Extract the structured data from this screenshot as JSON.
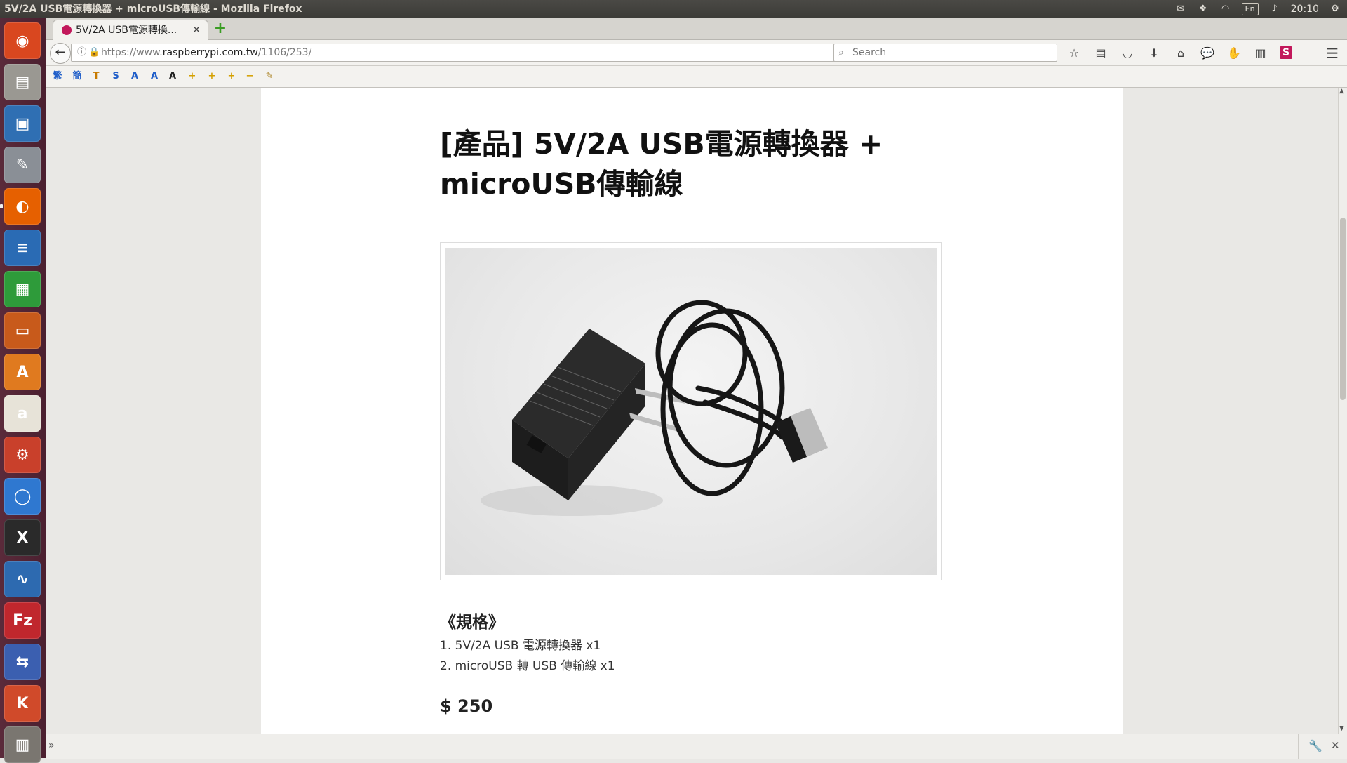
{
  "window": {
    "title": "5V/2A USB電源轉換器 + microUSB傳輸線 - Mozilla Firefox"
  },
  "tray": {
    "lang": "En",
    "clock": "20:10"
  },
  "launcher": {
    "apps": [
      {
        "name": "ubuntu-dash",
        "glyph": "◉",
        "color": "#d9471f"
      },
      {
        "name": "files",
        "glyph": "▤",
        "color": "#9a9892"
      },
      {
        "name": "remote-desktop",
        "glyph": "▣",
        "color": "#2f6fb3"
      },
      {
        "name": "image-editor",
        "glyph": "✎",
        "color": "#8a8f96"
      },
      {
        "name": "firefox",
        "glyph": "◐",
        "color": "#e66000"
      },
      {
        "name": "writer",
        "glyph": "≡",
        "color": "#2a6bb4"
      },
      {
        "name": "calc",
        "glyph": "▦",
        "color": "#2e9b3a"
      },
      {
        "name": "impress",
        "glyph": "▭",
        "color": "#c85a1b"
      },
      {
        "name": "software-center",
        "glyph": "A",
        "color": "#e07a1f"
      },
      {
        "name": "amazon",
        "glyph": "a",
        "color": "#e7e3d8"
      },
      {
        "name": "system-settings",
        "glyph": "⚙",
        "color": "#c9402b"
      },
      {
        "name": "chromium",
        "glyph": "◯",
        "color": "#2f78d0"
      },
      {
        "name": "xterm",
        "glyph": "X",
        "color": "#2a2a2a"
      },
      {
        "name": "system-monitor",
        "glyph": "∿",
        "color": "#2d6ab0"
      },
      {
        "name": "filezilla",
        "glyph": "Fz",
        "color": "#c0272d"
      },
      {
        "name": "network-tool",
        "glyph": "⇆",
        "color": "#3b5fb0"
      },
      {
        "name": "kdiff3",
        "glyph": "K",
        "color": "#d04a2a"
      },
      {
        "name": "stacked-apps",
        "glyph": "▥",
        "color": "#7a7670"
      }
    ]
  },
  "tabs": [
    {
      "label": "5V/2A USB電源轉換..."
    }
  ],
  "nav": {
    "url_prefix": "https://www.",
    "url_host": "raspberrypi.com.tw",
    "url_path": "/1106/253/",
    "search_placeholder": "Search"
  },
  "addon_toolbar": {
    "buttons": [
      {
        "name": "trad-chinese",
        "glyph": "繁",
        "color": "#1f5ec9"
      },
      {
        "name": "simp-chinese",
        "glyph": "簡",
        "color": "#1f5ec9"
      },
      {
        "name": "convert-t",
        "glyph": "T",
        "color": "#c77a00"
      },
      {
        "name": "convert-s",
        "glyph": "S",
        "color": "#1f5ec9"
      },
      {
        "name": "font-a-1",
        "glyph": "A",
        "color": "#1f5ec9"
      },
      {
        "name": "font-a-2",
        "glyph": "A",
        "color": "#1f5ec9"
      },
      {
        "name": "font-a-3",
        "glyph": "A",
        "color": "#222222"
      },
      {
        "name": "plus-1",
        "glyph": "+",
        "color": "#d4a000"
      },
      {
        "name": "plus-2",
        "glyph": "+",
        "color": "#d4a000"
      },
      {
        "name": "plus-3",
        "glyph": "+",
        "color": "#d4a000"
      },
      {
        "name": "minus",
        "glyph": "−",
        "color": "#d4a000"
      },
      {
        "name": "tools",
        "glyph": "✎",
        "color": "#b08a30"
      }
    ]
  },
  "product": {
    "title": "[產品] 5V/2A USB電源轉換器 + microUSB傳輸線",
    "spec_heading": "《規格》",
    "spec_items": [
      "1. 5V/2A USB 電源轉換器 x1",
      "2. microUSB 轉 USB 傳輸線 x1"
    ],
    "price": "$ 250"
  }
}
